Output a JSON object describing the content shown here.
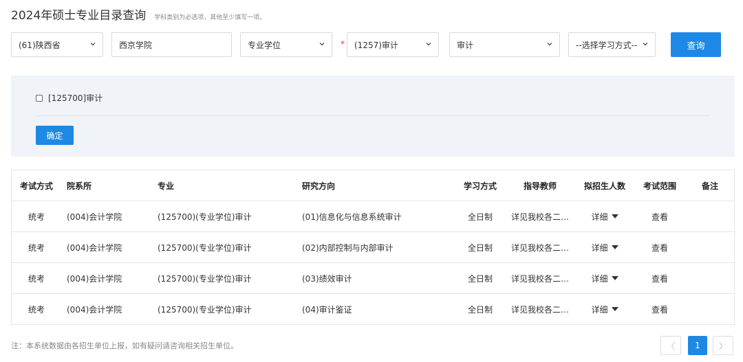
{
  "header": {
    "title": "2024年硕士专业目录查询",
    "hint": "学科类别为必选项，其他至少填写一项。"
  },
  "filters": {
    "province": "(61)陕西省",
    "school": "西京学院",
    "degree_type": "专业学位",
    "required_mark": "*",
    "discipline": "(1257)审计",
    "major": "审计",
    "study_mode": "--选择学习方式--",
    "search_label": "查询"
  },
  "panel": {
    "checkbox_label": "[125700]审计",
    "confirm_label": "确定"
  },
  "table": {
    "headers": [
      "考试方式",
      "院系所",
      "专业",
      "研究方向",
      "学习方式",
      "指导教师",
      "拟招生人数",
      "考试范围",
      "备注"
    ],
    "rows": [
      [
        "统考",
        "(004)会计学院",
        "(125700)(专业学位)审计",
        "(01)信息化与信息系统审计",
        "全日制",
        "详见我校各二…",
        "详细",
        "查看",
        ""
      ],
      [
        "统考",
        "(004)会计学院",
        "(125700)(专业学位)审计",
        "(02)内部控制与内部审计",
        "全日制",
        "详见我校各二…",
        "详细",
        "查看",
        ""
      ],
      [
        "统考",
        "(004)会计学院",
        "(125700)(专业学位)审计",
        "(03)绩效审计",
        "全日制",
        "详见我校各二…",
        "详细",
        "查看",
        ""
      ],
      [
        "统考",
        "(004)会计学院",
        "(125700)(专业学位)审计",
        "(04)审计鉴证",
        "全日制",
        "详见我校各二…",
        "详细",
        "查看",
        ""
      ]
    ]
  },
  "footer": {
    "note": "注：本系统数据由各招生单位上报，如有疑问请咨询相关招生单位。",
    "prev": "〈",
    "page": "1",
    "next": "〉"
  },
  "icons": {
    "dropdown": "chevron-down-icon",
    "expand": "caret-down-icon"
  },
  "colors": {
    "accent": "#1e88e5",
    "required": "#e53935",
    "panel_bg": "#f0f3f7"
  }
}
